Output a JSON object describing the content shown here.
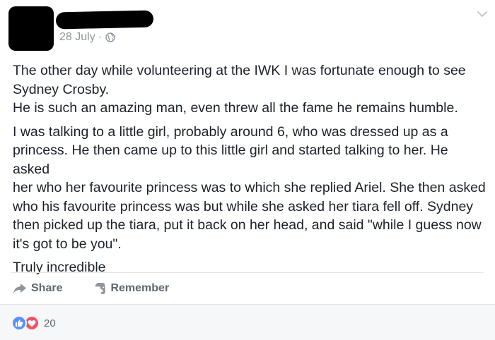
{
  "header": {
    "date": "28 July",
    "separator": "·",
    "privacy_icon": "globe-icon",
    "menu_icon": "chevron-down-icon"
  },
  "post": {
    "paragraph1_line1": "The other day while volunteering at the IWK I was fortunate enough to see",
    "paragraph1_line2": "Sydney Crosby.",
    "paragraph2": "He is such an amazing man, even threw all the fame he remains humble.",
    "paragraph3_lines": [
      "I was talking to a little girl, probably around 6, who was dressed up as a",
      "princess. He then came up to this little girl and started talking to her. He asked",
      "her who her favourite princess was to which she replied Ariel. She then asked",
      "who his favourite princess was but while she asked her tiara fell off. Sydney",
      "then picked up the tiara, put it back on her head, and said \"while I guess now",
      "it's got to be you\"."
    ],
    "paragraph4": "Truly incredible"
  },
  "actions": {
    "share_label": "Share",
    "remember_label": "Remember"
  },
  "reactions": {
    "count": "20",
    "types": [
      "like",
      "love"
    ]
  },
  "colors": {
    "like": "#5890ff",
    "love": "#f25268",
    "meta_text": "#90949c",
    "body_text": "#1d2129",
    "footer_bg": "#f6f7f9"
  }
}
